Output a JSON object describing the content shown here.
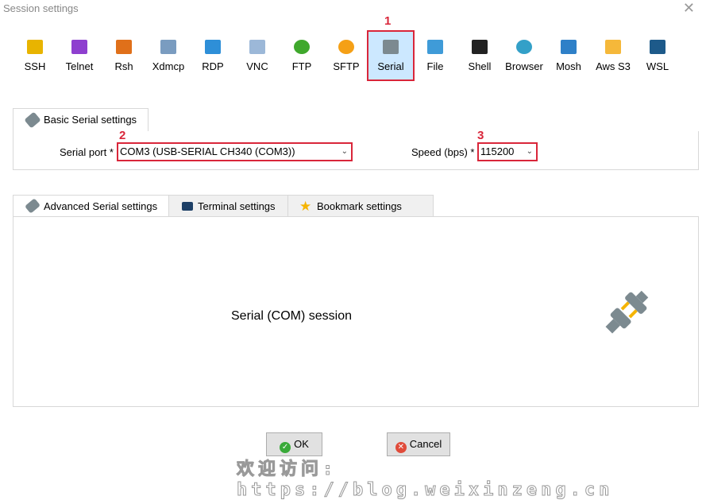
{
  "window": {
    "title": "Session settings"
  },
  "session_types": [
    {
      "label": "SSH",
      "icon": "key-icon",
      "color": "#e8b400"
    },
    {
      "label": "Telnet",
      "icon": "telnet-icon",
      "color": "#8e3fcf"
    },
    {
      "label": "Rsh",
      "icon": "gears-icon",
      "color": "#e0701a"
    },
    {
      "label": "Xdmcp",
      "icon": "x-monitor-icon",
      "color": "#7a9cc0"
    },
    {
      "label": "RDP",
      "icon": "windows-monitor-icon",
      "color": "#2e8fd8"
    },
    {
      "label": "VNC",
      "icon": "vnc-monitor-icon",
      "color": "#9cb8d8"
    },
    {
      "label": "FTP",
      "icon": "green-globe-icon",
      "color": "#3fa82c"
    },
    {
      "label": "SFTP",
      "icon": "orange-globe-icon",
      "color": "#f5a016"
    },
    {
      "label": "Serial",
      "icon": "serial-plug-icon",
      "color": "#7c8a90",
      "selected": true
    },
    {
      "label": "File",
      "icon": "file-monitor-icon",
      "color": "#3f9bd8"
    },
    {
      "label": "Shell",
      "icon": "terminal-icon",
      "color": "#222222"
    },
    {
      "label": "Browser",
      "icon": "globe-icon",
      "color": "#33a0c8"
    },
    {
      "label": "Mosh",
      "icon": "satellite-icon",
      "color": "#2e80c8"
    },
    {
      "label": "Aws S3",
      "icon": "cubes-icon",
      "color": "#f5b83a"
    },
    {
      "label": "WSL",
      "icon": "windows-icon",
      "color": "#1d5a8a"
    }
  ],
  "annotations": [
    "1",
    "2",
    "3"
  ],
  "basic_tab": {
    "label": "Basic Serial settings"
  },
  "serial_port": {
    "label": "Serial port *",
    "value": "COM3  (USB-SERIAL CH340 (COM3))"
  },
  "speed": {
    "label": "Speed (bps) *",
    "value": "115200"
  },
  "lower_tabs": [
    {
      "label": "Advanced Serial settings"
    },
    {
      "label": "Terminal settings"
    },
    {
      "label": "Bookmark settings"
    }
  ],
  "panel_text": "Serial (COM) session",
  "buttons": {
    "ok": "OK",
    "cancel": "Cancel"
  },
  "watermark": "欢迎访问: https://blog.weixinzeng.cn"
}
